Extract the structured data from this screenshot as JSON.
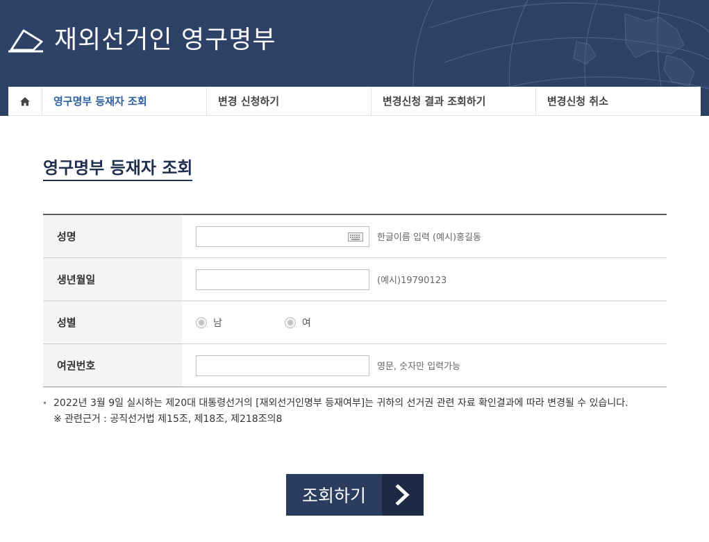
{
  "header": {
    "title": "재외선거인 영구명부",
    "logo_icon": "ballot-pencil-icon",
    "background_color": "#2e4166"
  },
  "nav": {
    "home_icon": "home-icon",
    "tabs": [
      {
        "label": "영구명부 등재자 조회",
        "active": true
      },
      {
        "label": "변경 신청하기",
        "active": false
      },
      {
        "label": "변경신청 결과 조회하기",
        "active": false
      },
      {
        "label": "변경신청 취소",
        "active": false
      }
    ],
    "active_color": "#2c5f9e"
  },
  "page": {
    "title": "영구명부 등재자 조회"
  },
  "form": {
    "name": {
      "label": "성명",
      "value": "",
      "hint": "한글이름 입력 (예시)홍길동",
      "keyboard_icon": "keyboard-icon"
    },
    "birth": {
      "label": "생년월일",
      "value": "",
      "hint": "(예시)19790123"
    },
    "gender": {
      "label": "성별",
      "options": [
        "남",
        "여"
      ]
    },
    "passport": {
      "label": "여권번호",
      "value": "",
      "hint": "영문, 숫자만 입력가능"
    }
  },
  "notes": {
    "main": "2022년 3월 9일 실시하는 제20대 대통령선거의 [재외선거인명부 등재여부]는 귀하의 선거권 관련 자료 확인결과에 따라 변경될 수 있습니다.",
    "reference": "※ 관련근거 : 공직선거법 제15조, 제18조, 제218조의8"
  },
  "submit": {
    "label": "조회하기",
    "arrow_icon": "chevron-right-icon",
    "color": "#2b3d5e"
  }
}
